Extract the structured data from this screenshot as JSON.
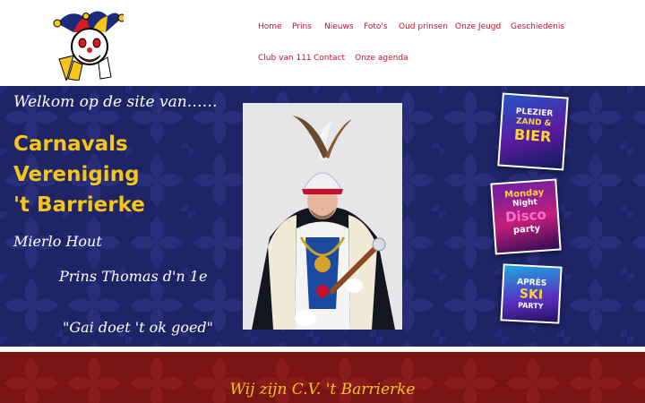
{
  "nav": {
    "items": [
      "Home",
      "Prins",
      "Nieuws",
      "Foto's",
      "Oud prinsen",
      "Onze Jeugd",
      "Geschiedenis",
      "Club van 111",
      "Contact",
      "Onze agenda"
    ]
  },
  "hero": {
    "welcome": "Welkom op de site van……",
    "club_name_lines": [
      "Carnavals",
      "Vereniging",
      "'t Barrierke"
    ],
    "location": "Mierlo Hout",
    "prince": "Prins Thomas d'n 1e",
    "motto": "\"Gai doet 't ok goed\""
  },
  "posters": [
    {
      "lines": [
        "PLEZIER",
        "ZAND &",
        "BIER"
      ]
    },
    {
      "lines": [
        "Monday",
        "Night",
        "Disco",
        "party"
      ]
    },
    {
      "lines": [
        "APRÈS",
        "SKI",
        "PARTY"
      ]
    }
  ],
  "band": {
    "title": "Wij zijn C.V. 't Barrierke"
  },
  "colors": {
    "nav_link": "#c8102e",
    "hero_bg": "#1e2466",
    "accent_yellow": "#f5c518",
    "band_bg": "#7a1414"
  },
  "icons": {
    "logo": "jester-logo-icon"
  }
}
